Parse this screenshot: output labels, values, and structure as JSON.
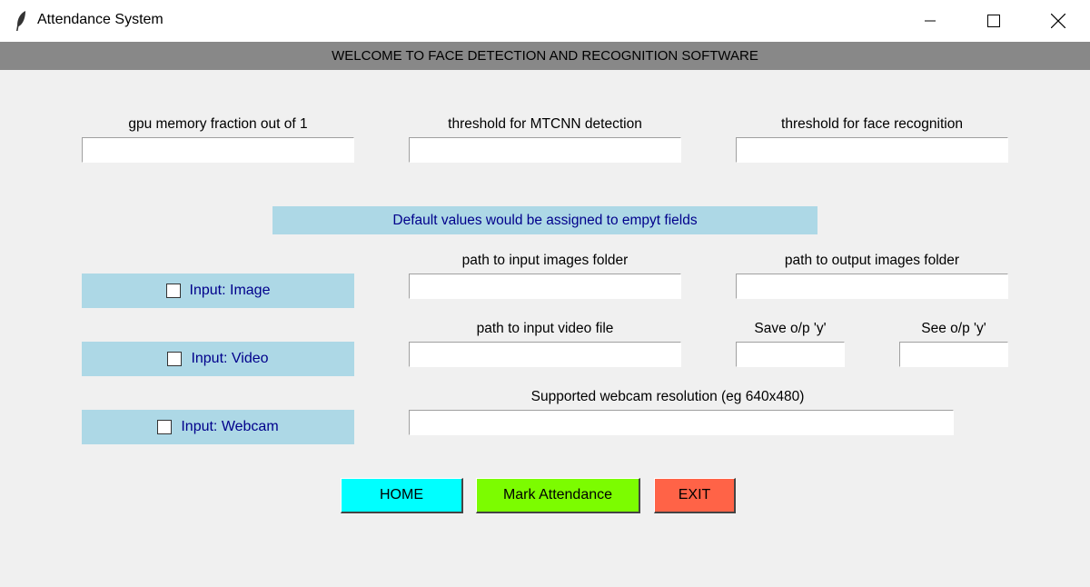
{
  "window": {
    "title": "Attendance System",
    "icon": "feather-icon",
    "controls": [
      "minimize-icon",
      "maximize-icon",
      "close-icon"
    ]
  },
  "banner": {
    "text": "WELCOME TO FACE DETECTION AND RECOGNITION SOFTWARE",
    "color": "#888888"
  },
  "fields": {
    "gpu_fraction": {
      "label": "gpu memory fraction out of 1",
      "value": ""
    },
    "mtcnn_threshold": {
      "label": "threshold for MTCNN detection",
      "value": ""
    },
    "recognition_threshold": {
      "label": "threshold for face recognition",
      "value": ""
    },
    "input_images": {
      "label": "path to input images folder",
      "value": ""
    },
    "output_images": {
      "label": "path to output images folder",
      "value": ""
    },
    "input_video": {
      "label": "path to input video file",
      "value": ""
    },
    "save_output": {
      "label": "Save o/p 'y'",
      "value": ""
    },
    "see_output": {
      "label": "See o/p 'y'",
      "value": ""
    },
    "webcam_resolution": {
      "label": "Supported webcam resolution (eg 640x480)",
      "value": ""
    }
  },
  "note": {
    "text": "Default values would be assigned to empyt fields",
    "color": "#add8e6"
  },
  "inputs": {
    "image": {
      "label": "Input: Image",
      "checked": false
    },
    "video": {
      "label": "Input: Video",
      "checked": false
    },
    "webcam": {
      "label": "Input: Webcam",
      "checked": false
    }
  },
  "buttons": {
    "home": {
      "label": "HOME",
      "color": "#00ffff"
    },
    "mark": {
      "label": "Mark Attendance",
      "color": "#7cfc00"
    },
    "exit": {
      "label": "EXIT",
      "color": "#ff6347"
    }
  }
}
